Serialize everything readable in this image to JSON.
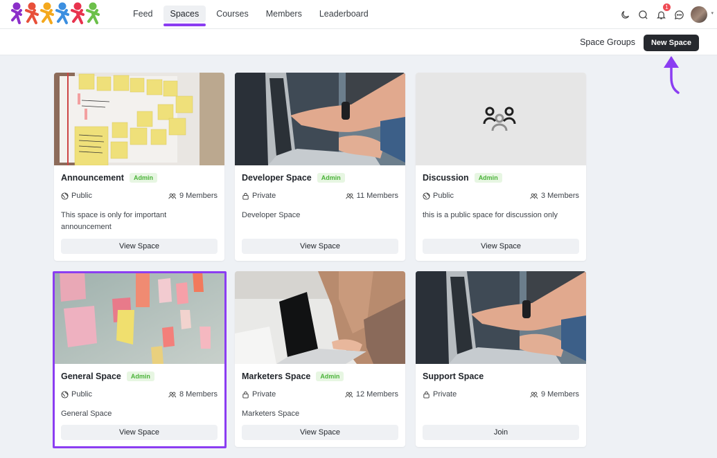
{
  "nav": {
    "items": [
      {
        "label": "Feed",
        "active": false
      },
      {
        "label": "Spaces",
        "active": true
      },
      {
        "label": "Courses",
        "active": false
      },
      {
        "label": "Members",
        "active": false
      },
      {
        "label": "Leaderboard",
        "active": false
      }
    ]
  },
  "header_icons": {
    "theme": "moon-icon",
    "search": "search-icon",
    "notifications": "bell-icon",
    "notification_count": "1",
    "messages": "chat-icon"
  },
  "subbar": {
    "space_groups_label": "Space Groups",
    "new_space_label": "New Space"
  },
  "colors": {
    "accent": "#8b3df2",
    "admin_badge_bg": "#e7f6e2",
    "admin_badge_text": "#4bb33a",
    "primary_button": "#26292e"
  },
  "spaces": [
    {
      "title": "Announcement",
      "badge": "Admin",
      "privacy": "Public",
      "members": "9 Members",
      "description": "This space is only for important announcement",
      "button": "View Space",
      "image": "sticky-notes-board"
    },
    {
      "title": "Developer Space",
      "badge": "Admin",
      "privacy": "Private",
      "members": "11 Members",
      "description": "Developer Space",
      "button": "View Space",
      "image": "laptop-pointing"
    },
    {
      "title": "Discussion",
      "badge": "Admin",
      "privacy": "Public",
      "members": "3 Members",
      "description": "this is a public space for discussion only",
      "button": "View Space",
      "image": "group-placeholder-icon"
    },
    {
      "title": "General Space",
      "badge": "Admin",
      "privacy": "Public",
      "members": "8 Members",
      "description": "General Space",
      "button": "View Space",
      "image": "sticky-notes-wall"
    },
    {
      "title": "Marketers Space",
      "badge": "Admin",
      "privacy": "Private",
      "members": "12 Members",
      "description": "Marketers Space",
      "button": "View Space",
      "image": "laptop-typing"
    },
    {
      "title": "Support Space",
      "badge": "",
      "privacy": "Private",
      "members": "9 Members",
      "description": "",
      "button": "Join",
      "image": "laptop-pointing"
    }
  ]
}
